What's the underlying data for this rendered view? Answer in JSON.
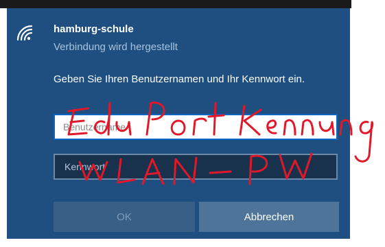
{
  "network": {
    "ssid": "hamburg-schule",
    "status": "Verbindung wird hergestellt",
    "wifi_icon": "wifi-signal-icon"
  },
  "prompt": "Geben Sie Ihren Benutzernamen und Ihr Kennwort ein.",
  "username_field": {
    "placeholder": "Benutzername",
    "value": ""
  },
  "password_field": {
    "placeholder": "Kennwort",
    "value": ""
  },
  "buttons": {
    "ok_label": "OK",
    "cancel_label": "Abbrechen"
  },
  "annotation": {
    "line1": "Edu Port Kennung",
    "line2": "WLAN-PW",
    "color": "#e0192a"
  },
  "colors": {
    "panel": "#1e4f80",
    "accent": "#0a66c2"
  }
}
